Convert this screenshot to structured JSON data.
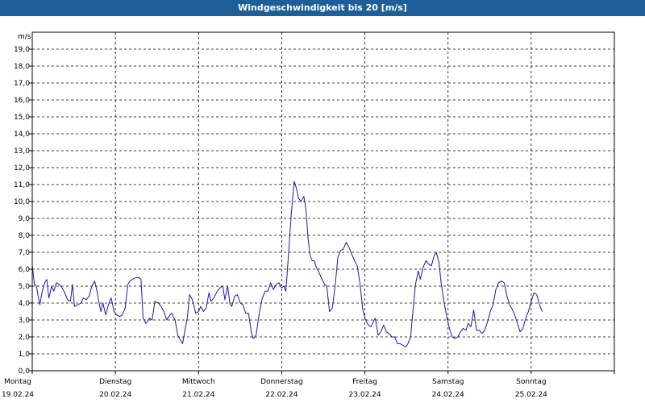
{
  "window": {
    "title": "Windgeschwindigkeit bis 20 [m/s]"
  },
  "chart_data": {
    "type": "line",
    "title": "Windgeschwindigkeit bis 20 [m/s]",
    "ylabel": "m/s",
    "ylim": [
      0,
      20
    ],
    "y_ticks": [
      "0,0",
      "1,0",
      "2,0",
      "3,0",
      "4,0",
      "5,0",
      "6,0",
      "7,0",
      "8,0",
      "9,0",
      "10,0",
      "11,0",
      "12,0",
      "13,0",
      "14,0",
      "15,0",
      "16,0",
      "17,0",
      "18,0",
      "19,0"
    ],
    "x_labels": [
      {
        "day": "Montag",
        "date": "19.02.24"
      },
      {
        "day": "Dienstag",
        "date": "20.02.24"
      },
      {
        "day": "Mittwoch",
        "date": "21.02.24"
      },
      {
        "day": "Donnerstag",
        "date": "22.02.24"
      },
      {
        "day": "Freitag",
        "date": "23.02.24"
      },
      {
        "day": "Samstag",
        "date": "24.02.24"
      },
      {
        "day": "Sonntag",
        "date": "25.02.24"
      }
    ],
    "grid": true,
    "line_color": "#1a1aa8",
    "series": [
      {
        "values": [
          [
            0.0,
            6.3
          ],
          [
            0.3,
            5.1
          ],
          [
            0.6,
            5.0
          ],
          [
            0.9,
            4.3
          ],
          [
            1.1,
            3.9
          ],
          [
            1.4,
            4.6
          ],
          [
            1.8,
            5.2
          ],
          [
            2.1,
            5.4
          ],
          [
            2.4,
            4.3
          ],
          [
            2.8,
            5.0
          ],
          [
            3.1,
            4.7
          ],
          [
            3.5,
            5.2
          ],
          [
            3.9,
            5.1
          ],
          [
            4.3,
            4.9
          ],
          [
            4.7,
            4.6
          ],
          [
            5.1,
            4.2
          ],
          [
            5.5,
            4.1
          ],
          [
            5.8,
            5.1
          ],
          [
            6.1,
            3.8
          ],
          [
            6.6,
            3.9
          ],
          [
            7.0,
            4.0
          ],
          [
            7.4,
            4.3
          ],
          [
            7.8,
            4.2
          ],
          [
            8.2,
            4.4
          ],
          [
            8.6,
            5.0
          ],
          [
            9.0,
            5.3
          ],
          [
            9.3,
            4.8
          ],
          [
            9.6,
            4.1
          ],
          [
            9.9,
            3.5
          ],
          [
            10.2,
            4.0
          ],
          [
            10.6,
            3.3
          ],
          [
            11.0,
            3.9
          ],
          [
            11.4,
            4.3
          ],
          [
            11.8,
            3.5
          ],
          [
            12.2,
            3.3
          ],
          [
            12.6,
            3.2
          ],
          [
            13.0,
            3.3
          ],
          [
            13.4,
            3.7
          ],
          [
            13.8,
            5.1
          ],
          [
            14.1,
            5.3
          ],
          [
            14.5,
            5.4
          ],
          [
            14.9,
            5.5
          ],
          [
            15.4,
            5.5
          ],
          [
            15.7,
            5.4
          ],
          [
            16.0,
            3.1
          ],
          [
            16.4,
            2.8
          ],
          [
            16.9,
            3.1
          ],
          [
            17.3,
            3.0
          ],
          [
            17.7,
            4.1
          ],
          [
            18.2,
            4.0
          ],
          [
            18.6,
            3.8
          ],
          [
            19.1,
            3.4
          ],
          [
            19.4,
            3.0
          ],
          [
            19.7,
            3.2
          ],
          [
            20.1,
            3.4
          ],
          [
            20.6,
            3.0
          ],
          [
            21.0,
            2.1
          ],
          [
            21.4,
            1.8
          ],
          [
            21.7,
            1.6
          ],
          [
            22.0,
            2.3
          ],
          [
            22.4,
            3.2
          ],
          [
            22.7,
            4.5
          ],
          [
            23.1,
            4.2
          ],
          [
            23.6,
            3.4
          ],
          [
            24.0,
            3.5
          ],
          [
            24.3,
            3.8
          ],
          [
            24.7,
            3.5
          ],
          [
            25.1,
            3.7
          ],
          [
            25.5,
            4.6
          ],
          [
            25.8,
            4.1
          ],
          [
            26.2,
            4.3
          ],
          [
            26.7,
            4.7
          ],
          [
            27.1,
            4.9
          ],
          [
            27.5,
            5.0
          ],
          [
            27.8,
            4.2
          ],
          [
            28.2,
            5.0
          ],
          [
            28.5,
            4.0
          ],
          [
            28.8,
            3.8
          ],
          [
            29.2,
            4.4
          ],
          [
            29.6,
            4.5
          ],
          [
            30.0,
            4.0
          ],
          [
            30.4,
            3.9
          ],
          [
            30.8,
            3.4
          ],
          [
            31.2,
            3.4
          ],
          [
            31.6,
            2.3
          ],
          [
            31.9,
            1.9
          ],
          [
            32.3,
            2.1
          ],
          [
            32.8,
            3.5
          ],
          [
            33.2,
            4.3
          ],
          [
            33.6,
            4.7
          ],
          [
            34.0,
            4.7
          ],
          [
            34.4,
            5.2
          ],
          [
            34.8,
            4.8
          ],
          [
            35.2,
            5.1
          ],
          [
            35.6,
            5.2
          ],
          [
            36.0,
            4.9
          ],
          [
            36.3,
            5.0
          ],
          [
            36.6,
            4.7
          ],
          [
            37.0,
            7.0
          ],
          [
            37.4,
            9.4
          ],
          [
            37.8,
            11.2
          ],
          [
            38.1,
            10.8
          ],
          [
            38.4,
            10.2
          ],
          [
            38.8,
            10.0
          ],
          [
            39.2,
            10.3
          ],
          [
            39.5,
            9.5
          ],
          [
            39.8,
            7.8
          ],
          [
            40.1,
            6.8
          ],
          [
            40.4,
            6.5
          ],
          [
            40.7,
            6.5
          ],
          [
            41.0,
            6.1
          ],
          [
            41.4,
            5.8
          ],
          [
            41.8,
            5.4
          ],
          [
            42.2,
            5.1
          ],
          [
            42.5,
            5.0
          ],
          [
            42.9,
            3.5
          ],
          [
            43.3,
            3.7
          ],
          [
            43.7,
            5.0
          ],
          [
            44.1,
            6.7
          ],
          [
            44.5,
            7.1
          ],
          [
            44.9,
            7.2
          ],
          [
            45.3,
            7.6
          ],
          [
            45.7,
            7.3
          ],
          [
            46.1,
            6.9
          ],
          [
            46.5,
            6.5
          ],
          [
            46.9,
            6.2
          ],
          [
            47.3,
            5.1
          ],
          [
            47.7,
            3.6
          ],
          [
            48.1,
            3.0
          ],
          [
            48.5,
            2.7
          ],
          [
            48.9,
            2.6
          ],
          [
            49.2,
            2.9
          ],
          [
            49.5,
            3.1
          ],
          [
            49.9,
            2.1
          ],
          [
            50.3,
            2.3
          ],
          [
            50.7,
            2.7
          ],
          [
            51.1,
            2.3
          ],
          [
            51.5,
            2.2
          ],
          [
            51.9,
            2.0
          ],
          [
            52.3,
            2.0
          ],
          [
            52.7,
            1.6
          ],
          [
            53.1,
            1.6
          ],
          [
            53.5,
            1.5
          ],
          [
            53.9,
            1.4
          ],
          [
            54.2,
            1.6
          ],
          [
            54.6,
            2.0
          ],
          [
            55.0,
            3.8
          ],
          [
            55.3,
            5.1
          ],
          [
            55.7,
            5.9
          ],
          [
            56.0,
            5.4
          ],
          [
            56.4,
            6.1
          ],
          [
            56.8,
            6.5
          ],
          [
            57.2,
            6.3
          ],
          [
            57.6,
            6.2
          ],
          [
            58.0,
            6.8
          ],
          [
            58.3,
            7.0
          ],
          [
            58.7,
            6.4
          ],
          [
            59.0,
            5.2
          ],
          [
            59.4,
            4.1
          ],
          [
            59.8,
            3.2
          ],
          [
            60.2,
            2.5
          ],
          [
            60.6,
            2.0
          ],
          [
            61.0,
            1.9
          ],
          [
            61.4,
            2.0
          ],
          [
            61.8,
            2.3
          ],
          [
            62.2,
            2.5
          ],
          [
            62.6,
            2.4
          ],
          [
            62.9,
            2.8
          ],
          [
            63.3,
            2.6
          ],
          [
            63.7,
            3.6
          ],
          [
            64.1,
            2.4
          ],
          [
            64.5,
            2.4
          ],
          [
            64.9,
            2.2
          ],
          [
            65.3,
            2.4
          ],
          [
            65.7,
            2.9
          ],
          [
            66.1,
            3.5
          ],
          [
            66.5,
            3.9
          ],
          [
            66.9,
            4.8
          ],
          [
            67.3,
            5.2
          ],
          [
            67.7,
            5.3
          ],
          [
            68.1,
            5.2
          ],
          [
            68.5,
            4.4
          ],
          [
            68.9,
            3.9
          ],
          [
            69.3,
            3.6
          ],
          [
            69.7,
            3.2
          ],
          [
            70.1,
            2.7
          ],
          [
            70.4,
            2.3
          ],
          [
            70.8,
            2.5
          ],
          [
            71.2,
            3.1
          ],
          [
            71.6,
            3.5
          ],
          [
            72.0,
            4.1
          ],
          [
            72.4,
            4.6
          ],
          [
            72.8,
            4.5
          ],
          [
            73.2,
            3.9
          ],
          [
            73.6,
            3.5
          ]
        ]
      }
    ]
  }
}
